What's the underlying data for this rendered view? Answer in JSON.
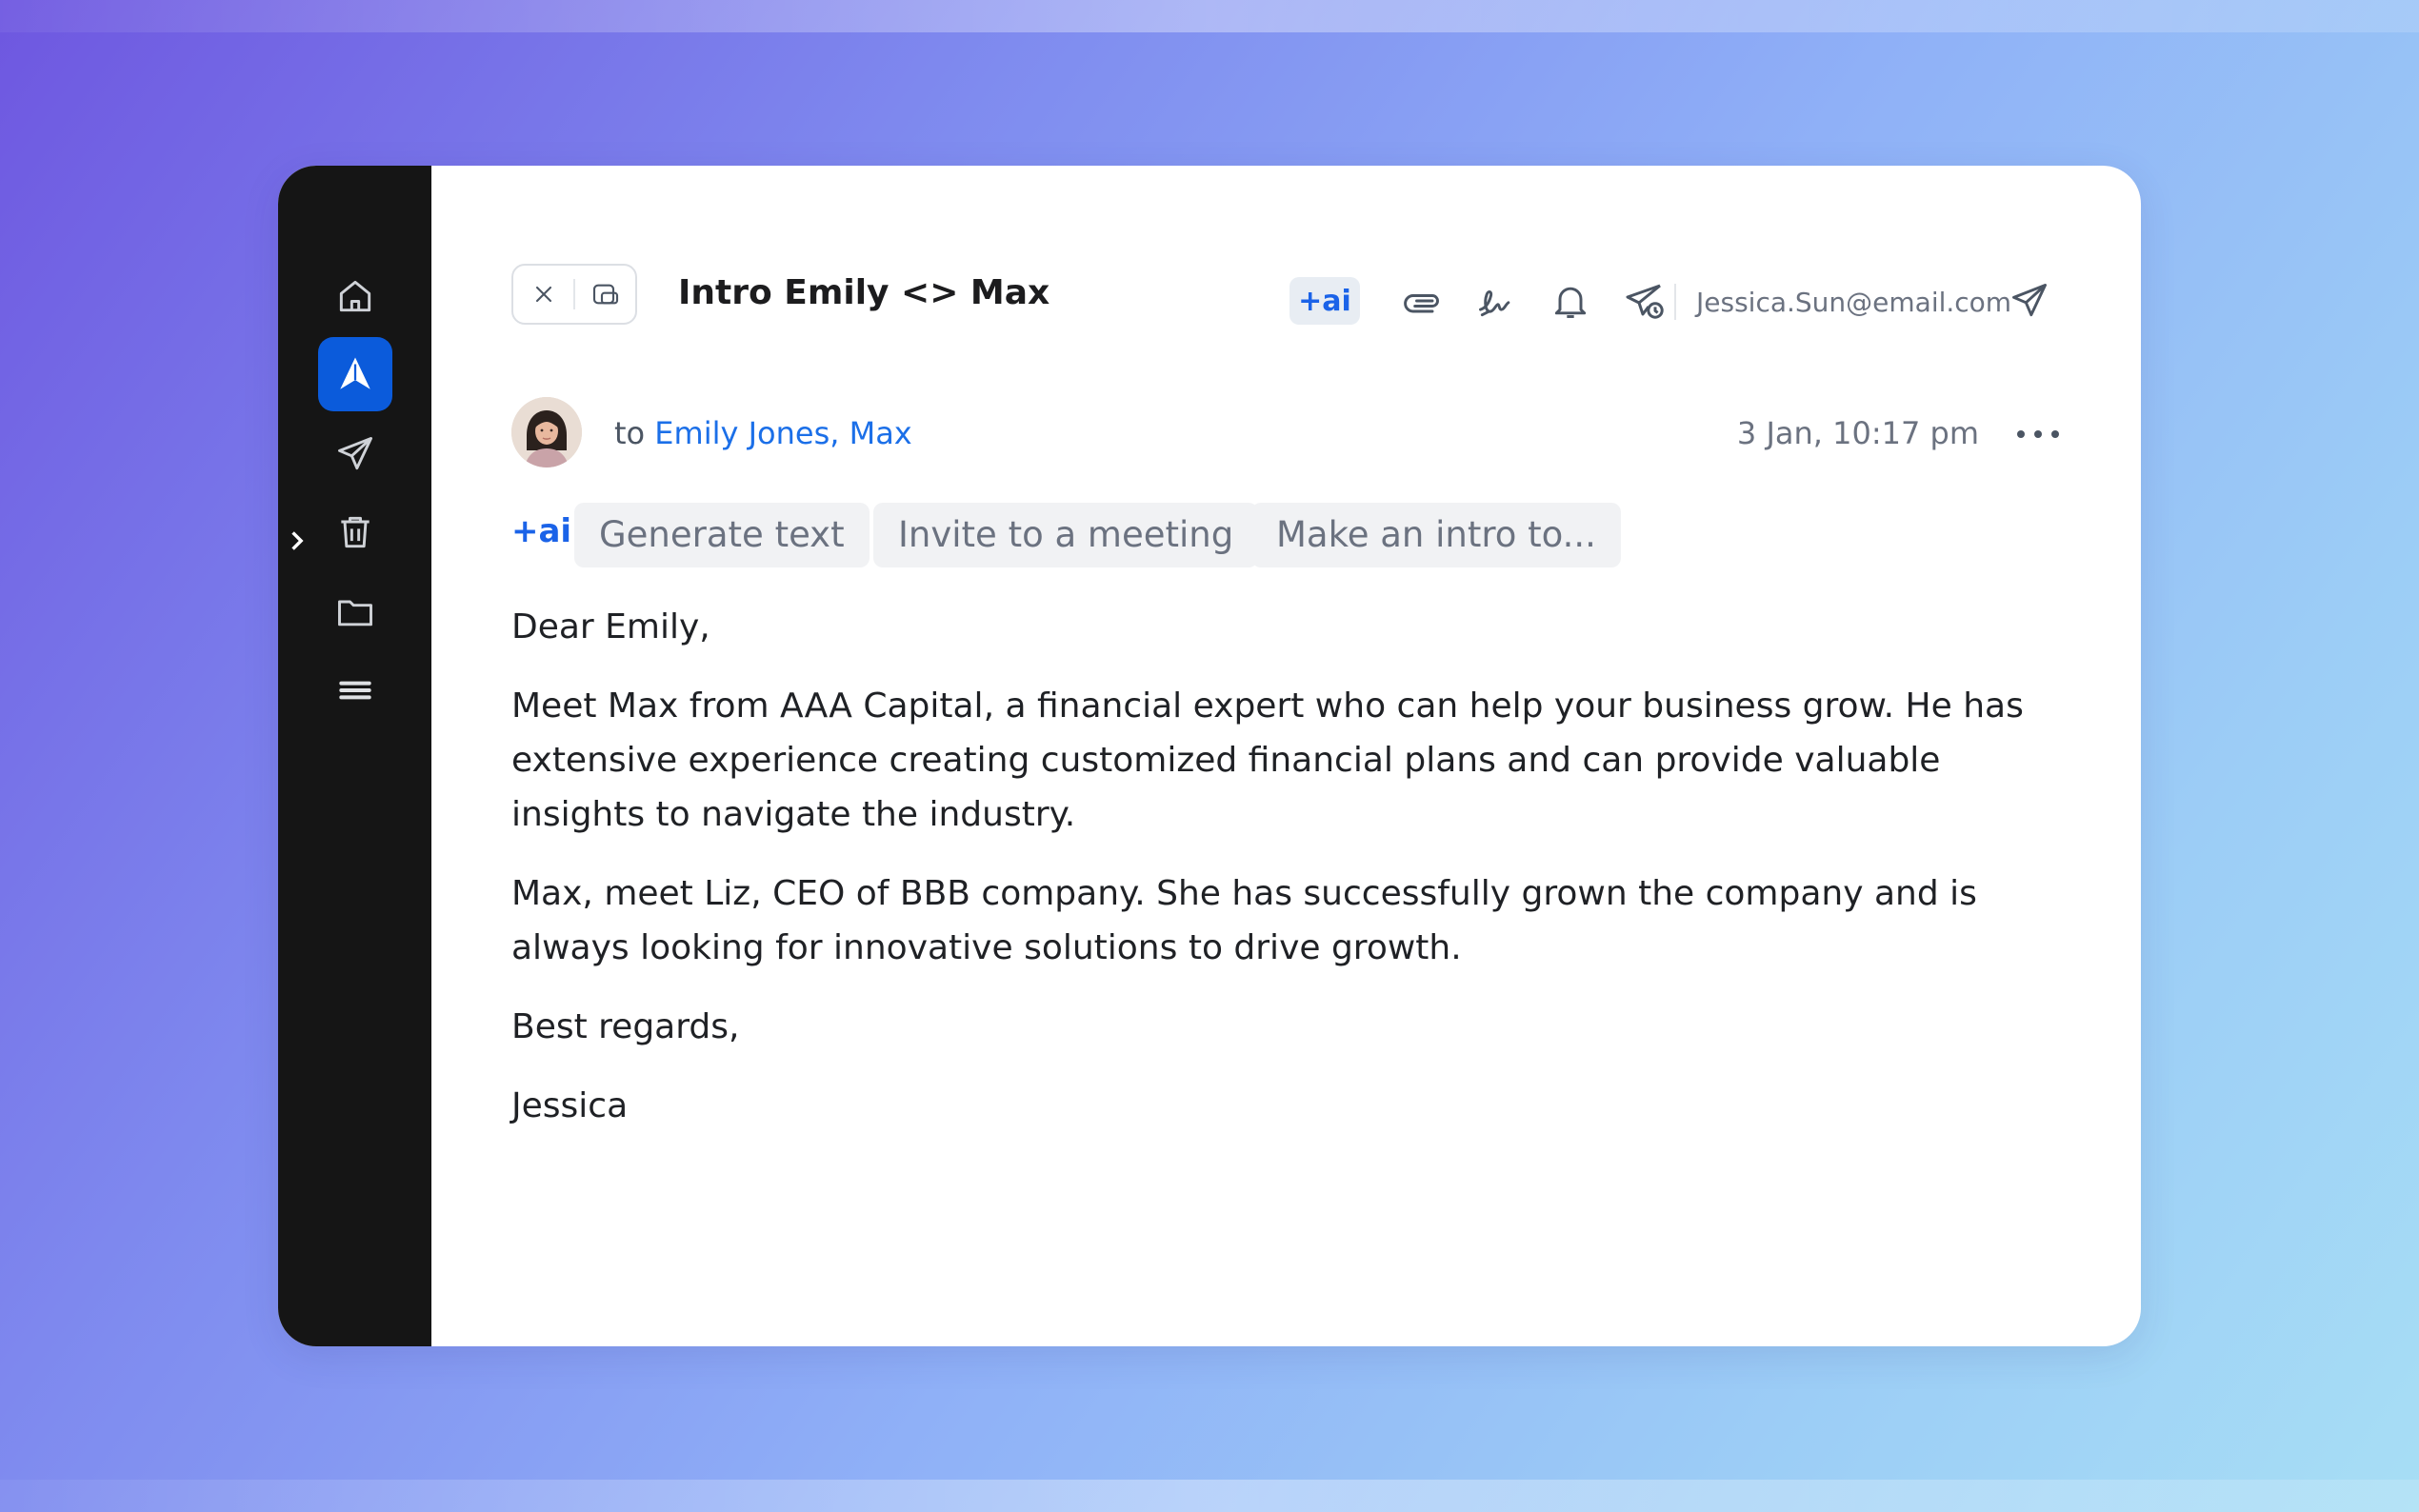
{
  "compose": {
    "subject": "Intro Emily <> Max",
    "toolbar": {
      "ai_label": "+ai",
      "from_address": "Jessica.Sun@email.com"
    },
    "recipients": {
      "prefix": "to",
      "names": "Emily Jones, Max"
    },
    "timestamp": "3 Jan, 10:17 pm",
    "ai_suggestions": {
      "label": "+ai",
      "chips": [
        "Generate text",
        "Invite to a meeting",
        "Make an intro to..."
      ]
    },
    "body": {
      "greeting": "Dear Emily,",
      "paragraphs": [
        "Meet Max from AAA Capital, a financial expert who can help your business grow. He has extensive experience creating customized financial plans and can provide valuable insights to navigate the industry.",
        "Max, meet Liz, CEO of BBB company. She has successfully grown the company and is always looking for innovative solutions to drive growth."
      ],
      "closing": "Best regards,",
      "signature": "Jessica"
    }
  },
  "sidebar": {
    "items": [
      "home-icon",
      "spark-logo-icon",
      "send-icon",
      "trash-icon",
      "folder-icon",
      "menu-icon"
    ],
    "active_item": "spark-logo-icon"
  },
  "colors": {
    "accent": "#1b63e8",
    "rail_bg": "#151515",
    "active_bg": "#0b5bdb"
  }
}
